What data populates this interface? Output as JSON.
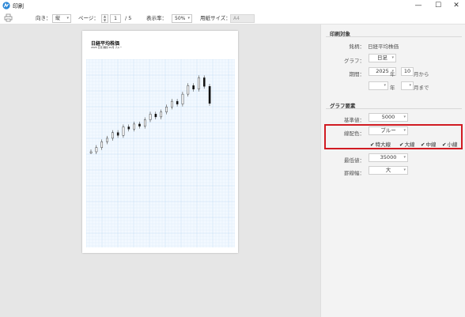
{
  "window": {
    "title": "印刷",
    "minimize_glyph": "—",
    "maximize_glyph": "☐",
    "close_glyph": "✕",
    "icon": "app-logo-icon"
  },
  "toolbar": {
    "print_icon": "printer-icon",
    "orientation_label": "向き：",
    "orientation_value": "縦",
    "page_label": "ページ：",
    "page_value": "1",
    "page_total": "/ 5",
    "zoom_label": "表示率：",
    "zoom_value": "50%",
    "paper_label": "用紙サイズ：",
    "paper_value": "A4"
  },
  "preview": {
    "chart_title": "日経平均株価",
    "chart_subtitle": "2025 日足 期間 10月 ブルー"
  },
  "chart_data": {
    "type": "candlestick",
    "series": [
      {
        "values": [
          32000,
          32600,
          33400,
          33900,
          34700,
          34300,
          35500,
          35200,
          35900,
          35600,
          36500,
          37300,
          36900,
          37600,
          38300,
          39100,
          38700,
          40100,
          41300,
          40800,
          42400,
          41200,
          38800
        ]
      }
    ],
    "grid": true,
    "ylim": [
      25000,
      45000
    ]
  },
  "print_target": {
    "section_title": "印刷対象",
    "symbol_label": "銘柄：",
    "symbol_value": "日経平均株価",
    "graph_label": "グラフ：",
    "graph_value": "日足",
    "period_label": "期間：",
    "year_value": "2025",
    "year_unit": "年",
    "month_value": "10",
    "month_unit": "月から",
    "end_year_unit": "年",
    "end_month_unit": "月まで"
  },
  "graph_elements": {
    "section_title": "グラフ要素",
    "base_label": "基準値：",
    "base_value": "5000",
    "line_color_label": "線配色：",
    "line_color_value": "ブルー",
    "lines": [
      {
        "label": "特大線",
        "checked": true
      },
      {
        "label": "大線",
        "checked": true
      },
      {
        "label": "中線",
        "checked": true
      },
      {
        "label": "小線",
        "checked": true
      }
    ],
    "check_glyph": "✔",
    "min_label": "最低値：",
    "min_value": "35000",
    "ruled_label": "罫線幅：",
    "ruled_value": "大"
  }
}
